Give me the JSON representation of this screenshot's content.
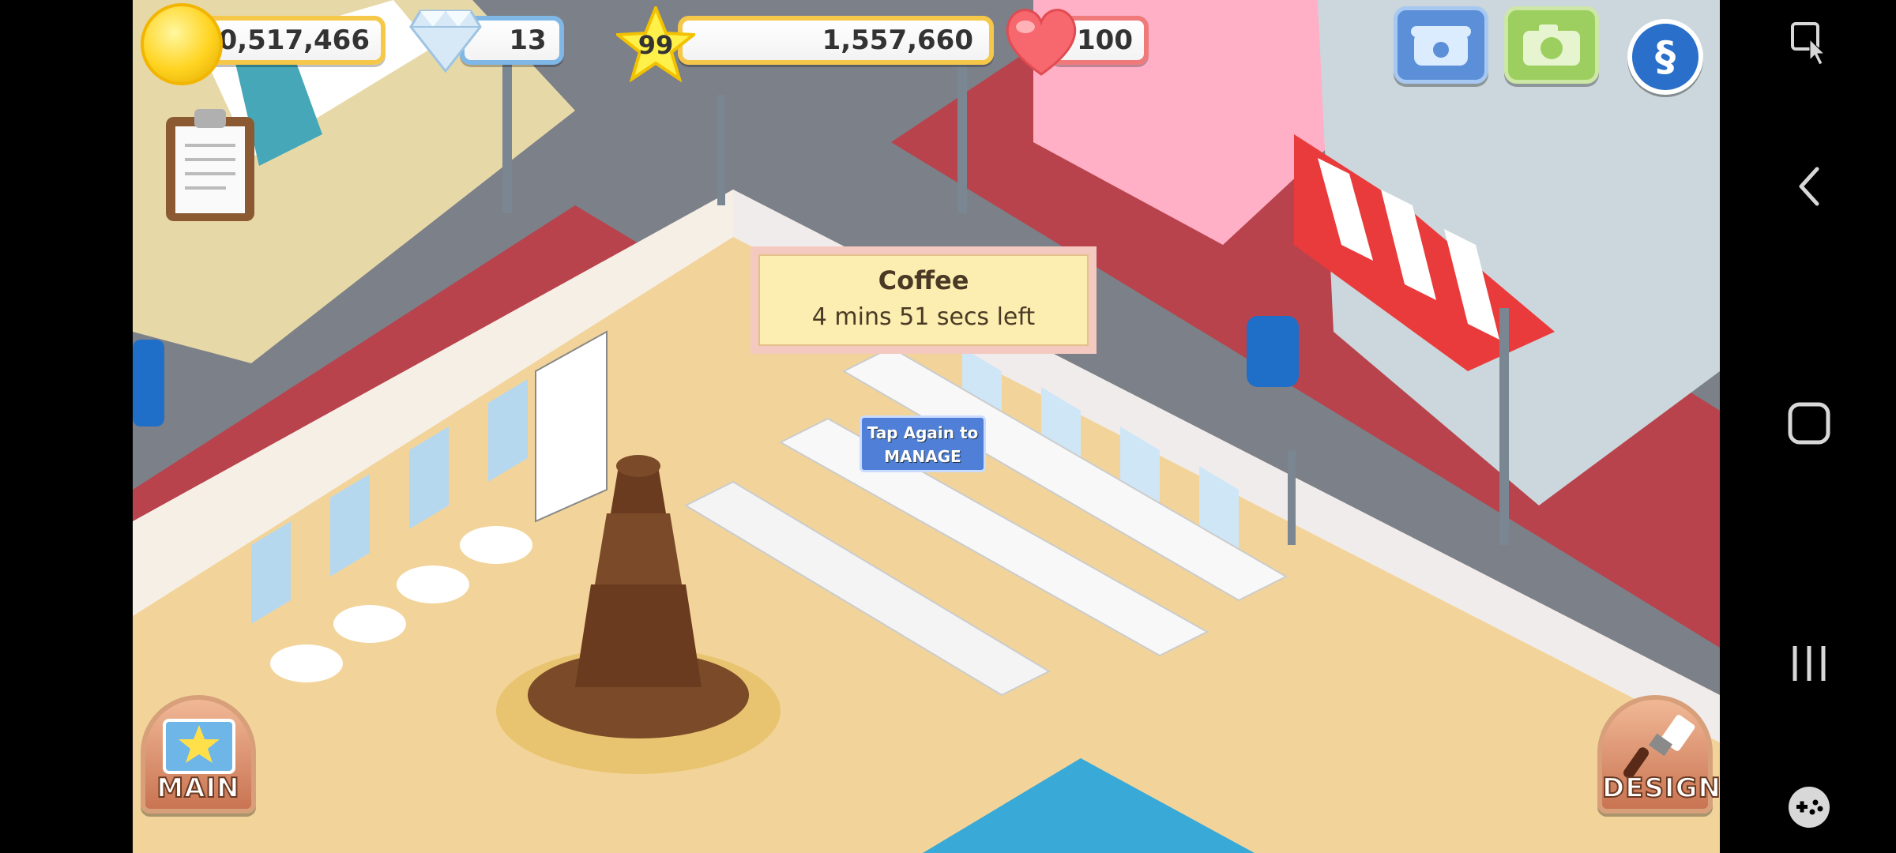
{
  "hud": {
    "coins": "40,517,466",
    "gems": "13",
    "level": "99",
    "xp": "1,557,660",
    "hearts": "100"
  },
  "icons": {
    "coin": "coin-icon",
    "gem": "diamond-icon",
    "level": "star-icon",
    "heart": "heart-icon",
    "clipboard": "clipboard-icon",
    "phone": "telephone-icon",
    "camera": "camera-icon",
    "swirl": "swirl-icon"
  },
  "tooltip": {
    "title": "Coffee",
    "time_left": "4 mins 51 secs left"
  },
  "tap_label": {
    "line1": "Tap Again to",
    "line2": "MANAGE"
  },
  "buttons": {
    "main": "MAIN",
    "design": "DESIGN"
  },
  "colors": {
    "coin_border": "#f6c84a",
    "gem_border": "#7fb7e6",
    "heart_border": "#f07a7a",
    "phone_button": "#5b8fd8",
    "camera_button": "#9ccf5f",
    "swirl_button": "#2a6fc9"
  }
}
